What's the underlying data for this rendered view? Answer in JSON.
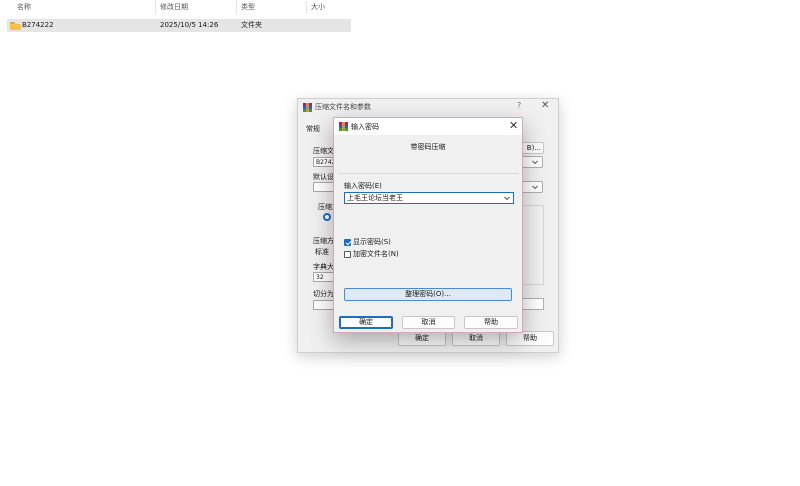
{
  "explorer": {
    "columns": {
      "name": "名称",
      "modified": "修改日期",
      "type": "类型",
      "size": "大小"
    },
    "files": [
      {
        "name": "B274222",
        "modified": "2025/10/5 14:26",
        "type": "文件夹",
        "size": ""
      }
    ]
  },
  "archive_dialog": {
    "title": "压缩文件名和参数",
    "help_glyph": "?",
    "close_glyph": "✕",
    "tab_general": "常规",
    "label_archive_name": "压缩文",
    "archive_name_value": "B2742",
    "browse_label": "B)...",
    "label_default_profile": "默认设",
    "label_format": "压缩文",
    "label_method": "压缩方",
    "method_value": "标准",
    "label_dictionary": "字典大",
    "dictionary_value": "32",
    "label_split": "切分为",
    "ok_label": "确定",
    "cancel_label": "取消",
    "help_label": "帮助"
  },
  "password_dialog": {
    "title": "输入密码",
    "close_glyph": "✕",
    "subtitle": "带密码压缩",
    "password_label": "输入密码(E)",
    "password_value": "上毛王论坛当老王",
    "show_password_label": "显示密码(S)",
    "show_password_checked": true,
    "encrypt_names_label": "加密文件名(N)",
    "encrypt_names_checked": false,
    "manage_passwords_label": "整理密码(O)...",
    "ok_label": "确定",
    "cancel_label": "取消",
    "help_label": "帮助"
  }
}
